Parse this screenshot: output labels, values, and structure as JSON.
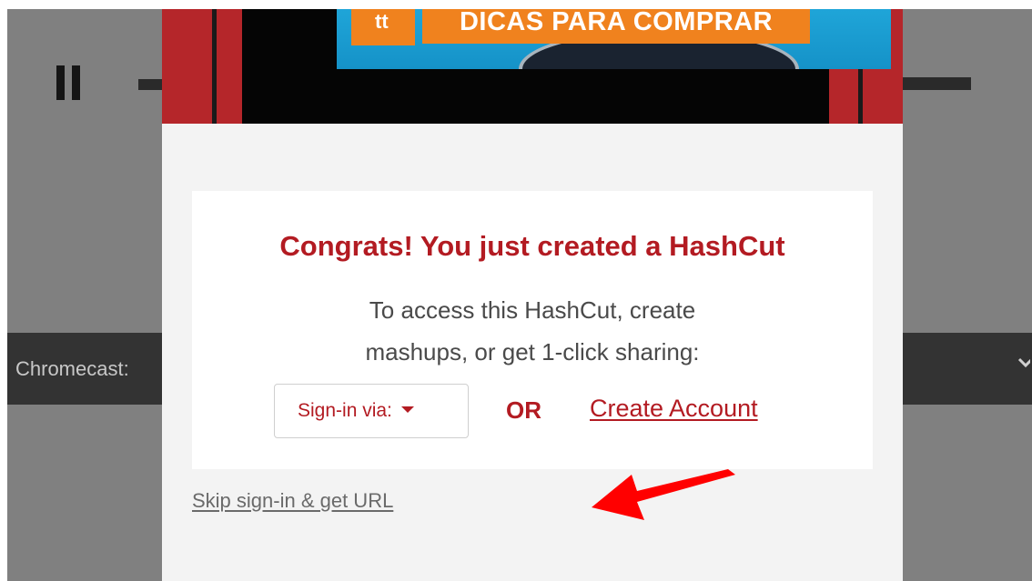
{
  "player": {
    "chromecast_label": "Chromecast:",
    "accent": "#333333"
  },
  "video": {
    "banner_text": "DICAS PARA COMPRAR",
    "logo_text": "tt",
    "banner_color": "#f0821e",
    "frame_color": "#b5262a"
  },
  "modal": {
    "title": "Congrats! You just created a HashCut",
    "message_line1": "To access this HashCut, create",
    "message_line2": "mashups, or get 1-click sharing:",
    "signin_label": "Sign-in via:",
    "or_label": "OR",
    "create_account_label": "Create Account",
    "skip_label": "Skip sign-in & get URL",
    "accent": "#b31b22"
  },
  "annotation": {
    "arrow_color": "#ff0000",
    "icon": "red-arrow-icon"
  }
}
